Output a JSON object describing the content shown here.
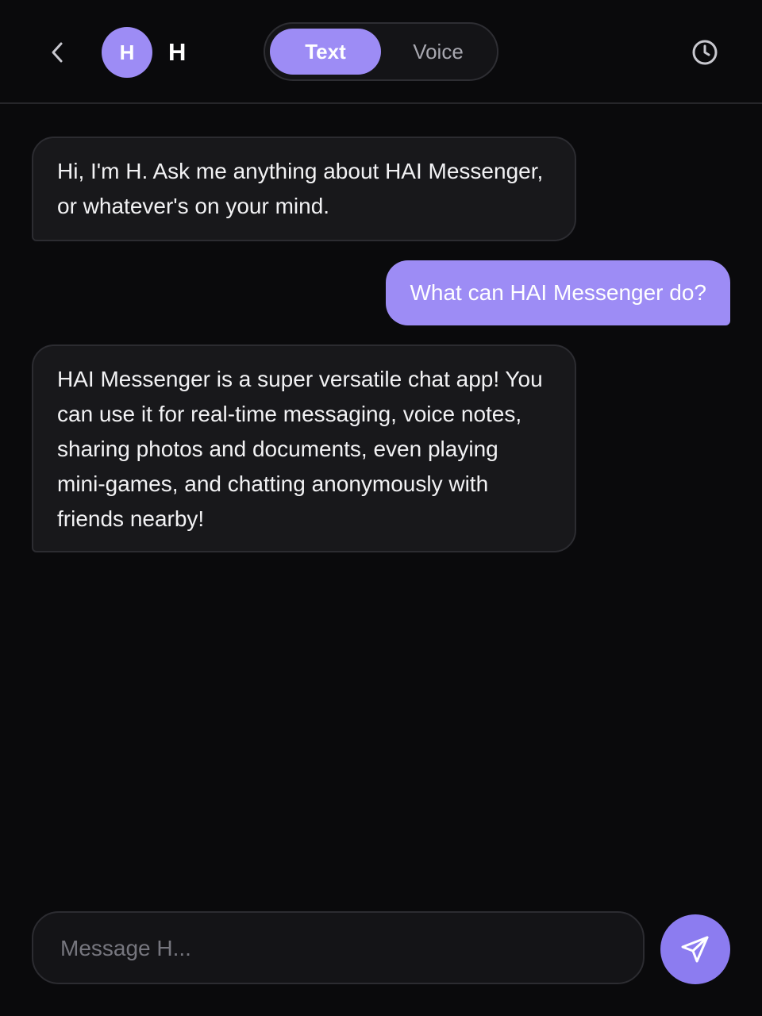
{
  "header": {
    "back_icon": "chevron-left-icon",
    "avatar_initial": "H",
    "contact_name": "H",
    "modes": [
      {
        "label": "Text",
        "active": true
      },
      {
        "label": "Voice",
        "active": false
      }
    ],
    "history_icon": "clock-icon"
  },
  "messages": [
    {
      "sender": "bot",
      "text": "Hi, I'm H. Ask me anything about HAI Messenger, or whatever's on your mind."
    },
    {
      "sender": "user",
      "text": "What can HAI Messenger do?"
    },
    {
      "sender": "bot",
      "text": "HAI Messenger is a super versatile chat app! You can use it for real-time messaging, voice notes, sharing photos and documents, even playing mini-games, and chatting anonymously with friends nearby!"
    }
  ],
  "composer": {
    "placeholder": "Message H...",
    "value": "",
    "send_icon": "send-icon"
  },
  "colors": {
    "accent": "#9d8cf5",
    "background": "#0a0a0c",
    "bubble_incoming": "#18181b"
  }
}
